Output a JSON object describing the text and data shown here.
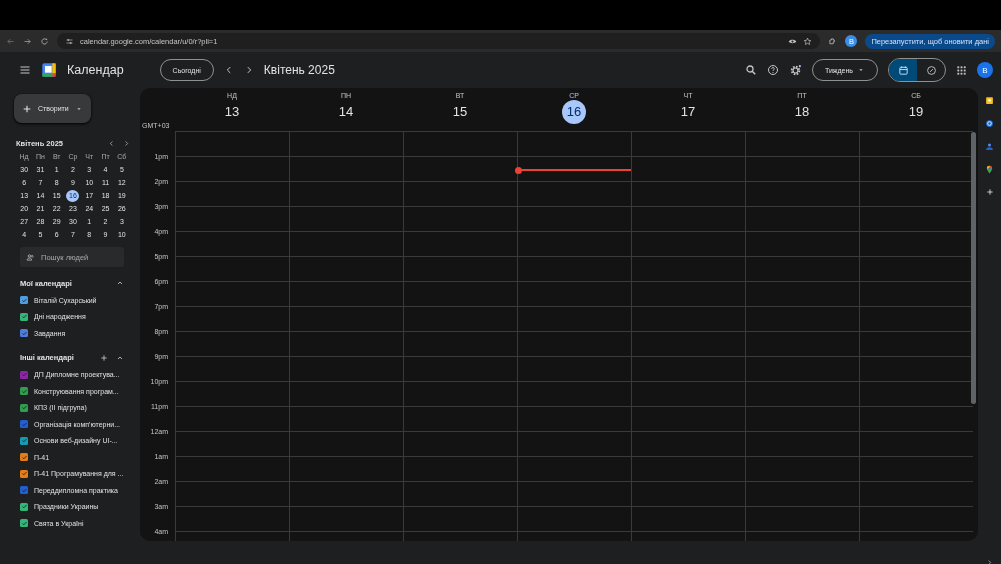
{
  "browser": {
    "url": "calendar.google.com/calendar/u/0/r?pli=1",
    "profile": "B",
    "restart_button": "Перезапустити, щоб оновити дані"
  },
  "header": {
    "app_name": "Календар",
    "today_button": "Сьогодні",
    "period": "Квітень 2025",
    "view_select": "Тиждень",
    "view_toggle": [
      {
        "kind": "calendar",
        "selected": true
      },
      {
        "kind": "tasks",
        "selected": false
      }
    ],
    "avatar": "В"
  },
  "sidebar": {
    "create_button": "Створити",
    "mini_calendar": {
      "title": "Квітень 2025",
      "weekdays": [
        "Нд",
        "Пн",
        "Вт",
        "Ср",
        "Чт",
        "Пт",
        "Сб"
      ],
      "weeks": [
        [
          {
            "label": "30",
            "selected": false
          },
          {
            "label": "31",
            "selected": false
          },
          {
            "label": "1",
            "selected": false
          },
          {
            "label": "2",
            "selected": false
          },
          {
            "label": "3",
            "selected": false
          },
          {
            "label": "4",
            "selected": false
          },
          {
            "label": "5",
            "selected": false
          }
        ],
        [
          {
            "label": "6",
            "selected": false
          },
          {
            "label": "7",
            "selected": false
          },
          {
            "label": "8",
            "selected": false
          },
          {
            "label": "9",
            "selected": false
          },
          {
            "label": "10",
            "selected": false
          },
          {
            "label": "11",
            "selected": false
          },
          {
            "label": "12",
            "selected": false
          }
        ],
        [
          {
            "label": "13",
            "selected": false
          },
          {
            "label": "14",
            "selected": false
          },
          {
            "label": "15",
            "selected": false
          },
          {
            "label": "16",
            "selected": true
          },
          {
            "label": "17",
            "selected": false
          },
          {
            "label": "18",
            "selected": false
          },
          {
            "label": "19",
            "selected": false
          }
        ],
        [
          {
            "label": "20",
            "selected": false
          },
          {
            "label": "21",
            "selected": false
          },
          {
            "label": "22",
            "selected": false
          },
          {
            "label": "23",
            "selected": false
          },
          {
            "label": "24",
            "selected": false
          },
          {
            "label": "25",
            "selected": false
          },
          {
            "label": "26",
            "selected": false
          }
        ],
        [
          {
            "label": "27",
            "selected": false
          },
          {
            "label": "28",
            "selected": false
          },
          {
            "label": "29",
            "selected": false
          },
          {
            "label": "30",
            "selected": false
          },
          {
            "label": "1",
            "selected": false
          },
          {
            "label": "2",
            "selected": false
          },
          {
            "label": "3",
            "selected": false
          }
        ],
        [
          {
            "label": "4",
            "selected": false
          },
          {
            "label": "5",
            "selected": false
          },
          {
            "label": "6",
            "selected": false
          },
          {
            "label": "7",
            "selected": false
          },
          {
            "label": "8",
            "selected": false
          },
          {
            "label": "9",
            "selected": false
          },
          {
            "label": "10",
            "selected": false
          }
        ]
      ]
    },
    "search_people": {
      "placeholder": "Пошук людей"
    },
    "sections": [
      {
        "title": "Мої календарі",
        "expanded": true,
        "can_add": false,
        "items": [
          {
            "label": "Віталій Сухарський",
            "color": "#4e9ee0",
            "checked": true
          },
          {
            "label": "Дні народження",
            "color": "#33b679",
            "checked": true
          },
          {
            "label": "Завдання",
            "color": "#4f7cdc",
            "checked": true
          }
        ]
      },
      {
        "title": "Інші календарі",
        "expanded": true,
        "can_add": true,
        "items": [
          {
            "label": "ДП Дипломне проектува...",
            "color": "#8e24aa",
            "checked": true
          },
          {
            "label": "Конструювання програм...",
            "color": "#2e9e4f",
            "checked": true
          },
          {
            "label": "КПЗ (ІІ підгрупа)",
            "color": "#2e9e4f",
            "checked": true
          },
          {
            "label": "Організація комп'ютерни...",
            "color": "#1f5fd0",
            "checked": true
          },
          {
            "label": "Основи веб-дизайну UI-...",
            "color": "#129eaf",
            "checked": true
          },
          {
            "label": "П-41",
            "color": "#e67c15",
            "checked": true
          },
          {
            "label": "П-41 Програмування для ...",
            "color": "#e67c15",
            "checked": true
          },
          {
            "label": "Переддипломна практика",
            "color": "#1f5fd0",
            "checked": true
          },
          {
            "label": "Праздники Украины",
            "color": "#33b679",
            "checked": true
          },
          {
            "label": "Свята в Україні",
            "color": "#33b679",
            "checked": true
          }
        ]
      }
    ]
  },
  "week": {
    "timezone": "GMT+03",
    "days": [
      {
        "weekday": "НД",
        "date": "13",
        "today": false
      },
      {
        "weekday": "ПН",
        "date": "14",
        "today": false
      },
      {
        "weekday": "ВТ",
        "date": "15",
        "today": false
      },
      {
        "weekday": "СР",
        "date": "16",
        "today": true
      },
      {
        "weekday": "ЧТ",
        "date": "17",
        "today": false
      },
      {
        "weekday": "ПТ",
        "date": "18",
        "today": false
      },
      {
        "weekday": "СБ",
        "date": "19",
        "today": false
      }
    ],
    "times": [
      "1pm",
      "2pm",
      "3pm",
      "4pm",
      "5pm",
      "6pm",
      "7pm",
      "8pm",
      "9pm",
      "10pm",
      "11pm",
      "12am",
      "1am",
      "2am",
      "3am",
      "4am"
    ]
  }
}
